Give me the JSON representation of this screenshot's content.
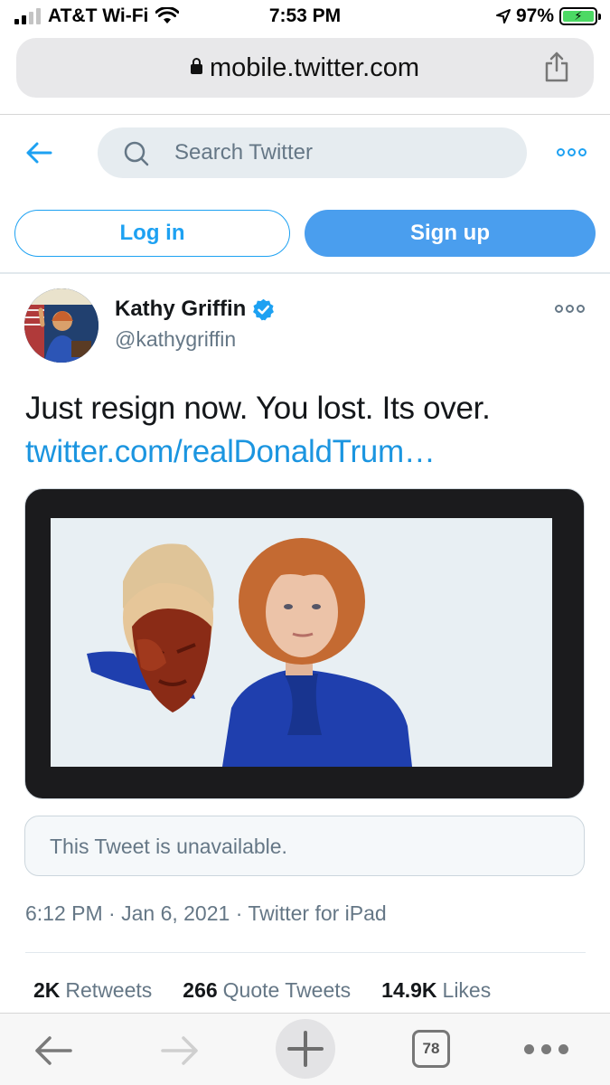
{
  "status_bar": {
    "carrier": "AT&T Wi-Fi",
    "time": "7:53 PM",
    "battery": "97%"
  },
  "browser": {
    "url": "mobile.twitter.com",
    "open_tabs": "78"
  },
  "header": {
    "search_placeholder": "Search Twitter",
    "login_label": "Log in",
    "signup_label": "Sign up"
  },
  "tweet": {
    "display_name": "Kathy Griffin",
    "handle": "@kathygriffin",
    "text": "Just resign now. You lost. Its over.",
    "link": "twitter.com/realDonaldTrum…",
    "quoted_unavailable": "This Tweet is unavailable.",
    "timestamp": "6:12 PM · Jan 6, 2021 · Twitter for iPad",
    "stats": {
      "retweets_count": "2K",
      "retweets_label": "Retweets",
      "quotes_count": "266",
      "quotes_label": "Quote Tweets",
      "likes_count": "14.9K",
      "likes_label": "Likes"
    }
  },
  "colors": {
    "twitter_blue": "#1da1f2",
    "link_blue": "#1b95e0",
    "signup_blue": "#4a9eee",
    "secondary_text": "#657786"
  }
}
